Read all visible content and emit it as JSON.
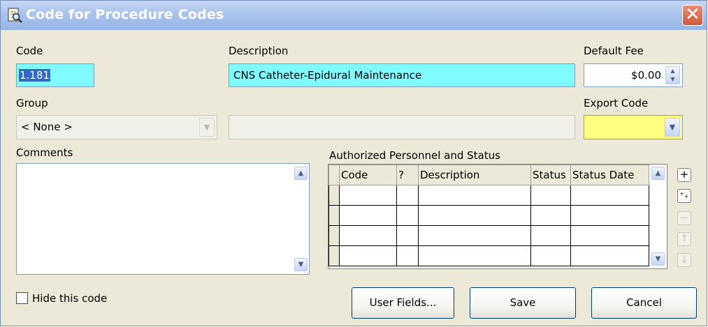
{
  "window": {
    "title": "Code for Procedure Codes",
    "close_glyph": "✕",
    "title_icon": "magnifier-document-icon"
  },
  "labels": {
    "code": "Code",
    "description": "Description",
    "default_fee": "Default Fee",
    "group": "Group",
    "export_code": "Export Code",
    "comments": "Comments",
    "authorized": "Authorized Personnel and Status"
  },
  "fields": {
    "code_value": "1.181",
    "description_value": "CNS Catheter-Epidural Maintenance",
    "default_fee_value": "$0.00",
    "group_value": "< None >",
    "group_description_value": "",
    "export_code_value": "",
    "comments_value": ""
  },
  "colors": {
    "highlight_cyan": "#80fbff",
    "export_yellow": "#ffff80",
    "selection_blue": "#316ac5"
  },
  "grid": {
    "columns": [
      "",
      "Code",
      "?",
      "Description",
      "Status",
      "Status Date"
    ],
    "rows": [
      [
        "",
        "",
        "",
        "",
        "",
        ""
      ],
      [
        "",
        "",
        "",
        "",
        "",
        ""
      ],
      [
        "",
        "",
        "",
        "",
        "",
        ""
      ],
      [
        "",
        "",
        "",
        "",
        "",
        ""
      ]
    ]
  },
  "side_buttons": {
    "add": "+",
    "add_multi": "⁺₊",
    "remove": "−",
    "move_up": "↑",
    "move_down": "↓"
  },
  "scroll_glyphs": {
    "up": "▲",
    "down": "▼",
    "dropdown": "▼"
  },
  "checkbox": {
    "label": "Hide this code",
    "checked": false
  },
  "buttons": {
    "user_fields": "User Fields...",
    "save": "Save",
    "cancel": "Cancel"
  }
}
